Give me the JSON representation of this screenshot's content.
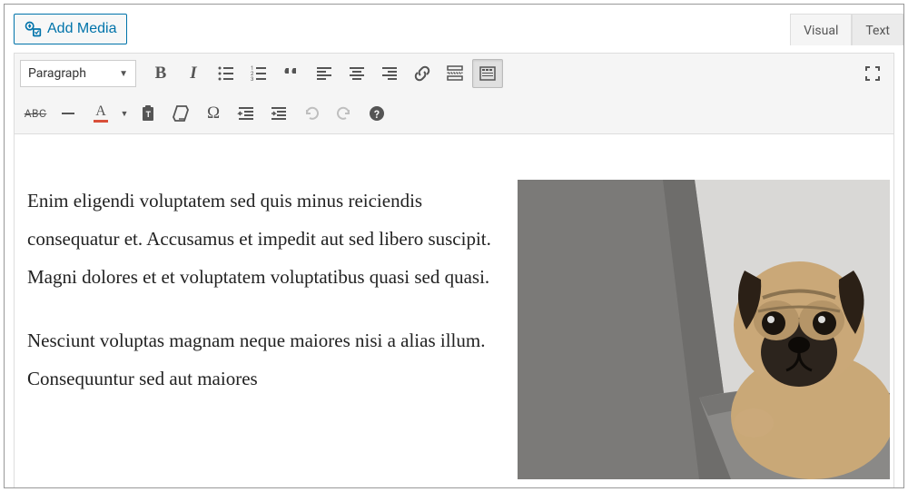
{
  "addMedia": {
    "label": "Add Media"
  },
  "tabs": {
    "visual": "Visual",
    "text": "Text"
  },
  "formatSelect": {
    "value": "Paragraph"
  },
  "content": {
    "p1": "Enim eligendi voluptatem sed quis minus reiciendis consequatur et. Accusamus et impedit aut sed libero suscipit. Magni dolores et et voluptatem voluptatibus quasi sed quasi.",
    "p2": "Nesciunt voluptas magnam neque maiores nisi a alias illum. Consequuntur sed aut maiores"
  },
  "image": {
    "alt": "pug peeking from behind a gray chair"
  }
}
